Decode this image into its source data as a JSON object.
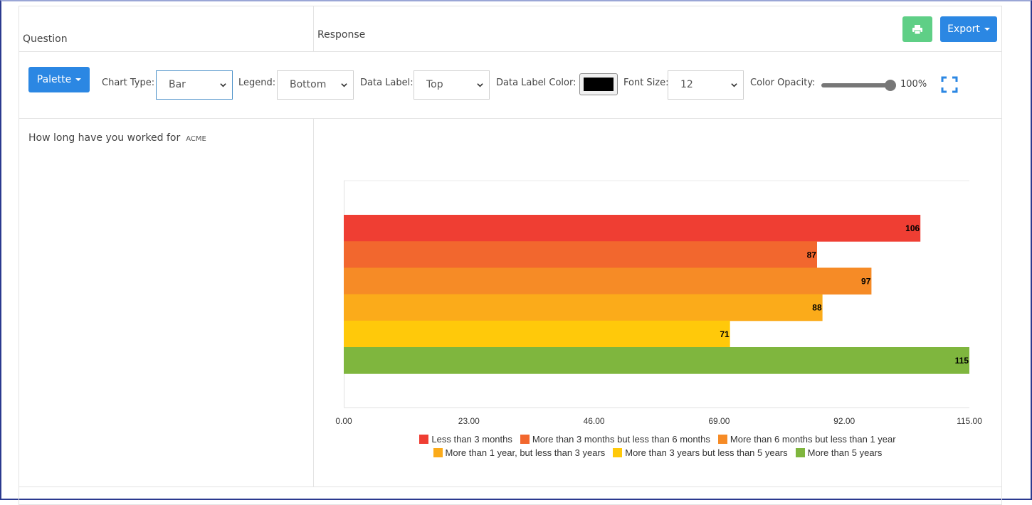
{
  "header": {
    "question_col": "Question",
    "response_col": "Response",
    "export_label": "Export"
  },
  "toolbar": {
    "palette_label": "Palette",
    "chart_type_label": "Chart Type:",
    "chart_type_value": "Bar",
    "legend_label": "Legend:",
    "legend_value": "Bottom",
    "data_label_label": "Data Label:",
    "data_label_value": "Top",
    "data_label_color_label": "Data Label Color:",
    "data_label_color": "#000000",
    "font_size_label": "Font Size:",
    "font_size_value": "12",
    "opacity_label": "Color Opacity:",
    "opacity_value": "100%",
    "opacity_fraction": 1.0
  },
  "question": {
    "text": "How long have you worked for",
    "tag": "ACME"
  },
  "colors": {
    "accent": "#2b87e3",
    "print_button": "#5fcf86"
  },
  "chart_data": {
    "type": "bar",
    "orientation": "horizontal",
    "categories": [
      "Less than 3 months",
      "More than 3 months but less than 6 months",
      "More than 6 months but less than 1 year",
      "More than 1 year, but less than 3 years",
      "More than 3 years but less than 5 years",
      "More than 5 years"
    ],
    "values": [
      106,
      87,
      97,
      88,
      71,
      115
    ],
    "colors": [
      "#ef3e33",
      "#f2672e",
      "#f68b26",
      "#fbab1a",
      "#ffc90a",
      "#7fb63e"
    ],
    "xlim": [
      0,
      115
    ],
    "x_ticks": [
      "0.00",
      "23.00",
      "46.00",
      "69.00",
      "92.00",
      "115.00"
    ],
    "data_labels": true,
    "legend": "bottom",
    "grid": false
  }
}
